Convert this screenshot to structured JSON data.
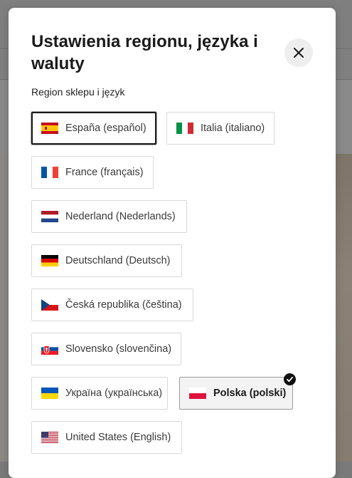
{
  "modal": {
    "title": "Ustawienia regionu, języka i waluty",
    "close_icon": "close-icon",
    "section_label": "Region sklepu i język"
  },
  "options": [
    {
      "label": "España (español)",
      "flag": "flag-spain",
      "state": "focused"
    },
    {
      "label": "Italia (italiano)",
      "flag": "flag-italy",
      "state": "default"
    },
    {
      "label": "France (français)",
      "flag": "flag-france",
      "state": "default"
    },
    {
      "label": "Nederland (Nederlands)",
      "flag": "flag-netherlands",
      "state": "default"
    },
    {
      "label": "Deutschland (Deutsch)",
      "flag": "flag-germany",
      "state": "default"
    },
    {
      "label": "Česká republika (čeština)",
      "flag": "flag-czech",
      "state": "default"
    },
    {
      "label": "Slovensko (slovenčina)",
      "flag": "flag-slovakia",
      "state": "default"
    },
    {
      "label": "Україна (українська)",
      "flag": "flag-ukraine",
      "state": "default"
    },
    {
      "label": "Polska (polski)",
      "flag": "flag-poland",
      "state": "selected"
    },
    {
      "label": "United States (English)",
      "flag": "flag-usa",
      "state": "default"
    }
  ],
  "colors": {
    "overlay": "#7a7a7a",
    "selected_bg": "#f3f3f3",
    "check_bg": "#111111"
  }
}
